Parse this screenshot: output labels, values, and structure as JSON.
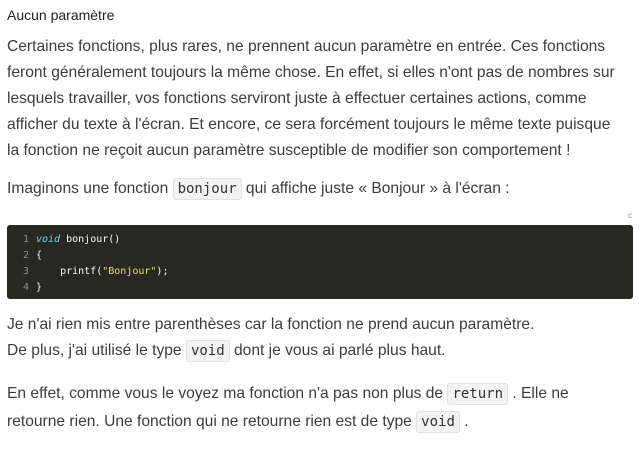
{
  "heading": "Aucun paramètre",
  "para1": {
    "lines": [
      "Certaines fonctions, plus rares, ne prennent aucun paramètre en entrée. Ces fonctions",
      "feront généralement toujours la même chose. En effet, si elles n'ont pas de nombres sur",
      "lesquels travailler, vos fonctions serviront juste à effectuer certaines actions, comme",
      "afficher du texte à l'écran. Et encore, ce sera forcément toujours le même texte puisque",
      "la fonction ne reçoit aucun paramètre susceptible de modifier son comportement !"
    ]
  },
  "para2": {
    "before": "Imaginons une fonction ",
    "code": "bonjour",
    "after": " qui affiche juste « Bonjour » à l'écran :"
  },
  "code_block": {
    "lang": "c",
    "line_numbers": [
      "1",
      "2",
      "3",
      "4"
    ],
    "l1_kw": "void",
    "l1_rest": " bonjour()",
    "l2": "{",
    "l3_pre": "    printf(",
    "l3_str": "\"Bonjour\"",
    "l3_post": ");",
    "l4": "}"
  },
  "para3": {
    "line1": "Je n'ai rien mis entre parenthèses car la fonction ne prend aucun paramètre.",
    "line2_before": "De plus, j'ai utilisé le type ",
    "line2_code": "void",
    "line2_after": " dont je vous ai parlé plus haut."
  },
  "para4": {
    "line1_before": "En effet, comme vous le voyez ma fonction n'a pas non plus de ",
    "line1_code": "return",
    "line1_after": " . Elle ne",
    "line2_before": "retourne rien. Une fonction qui ne retourne rien est de type ",
    "line2_code": "void",
    "line2_after": " ."
  }
}
